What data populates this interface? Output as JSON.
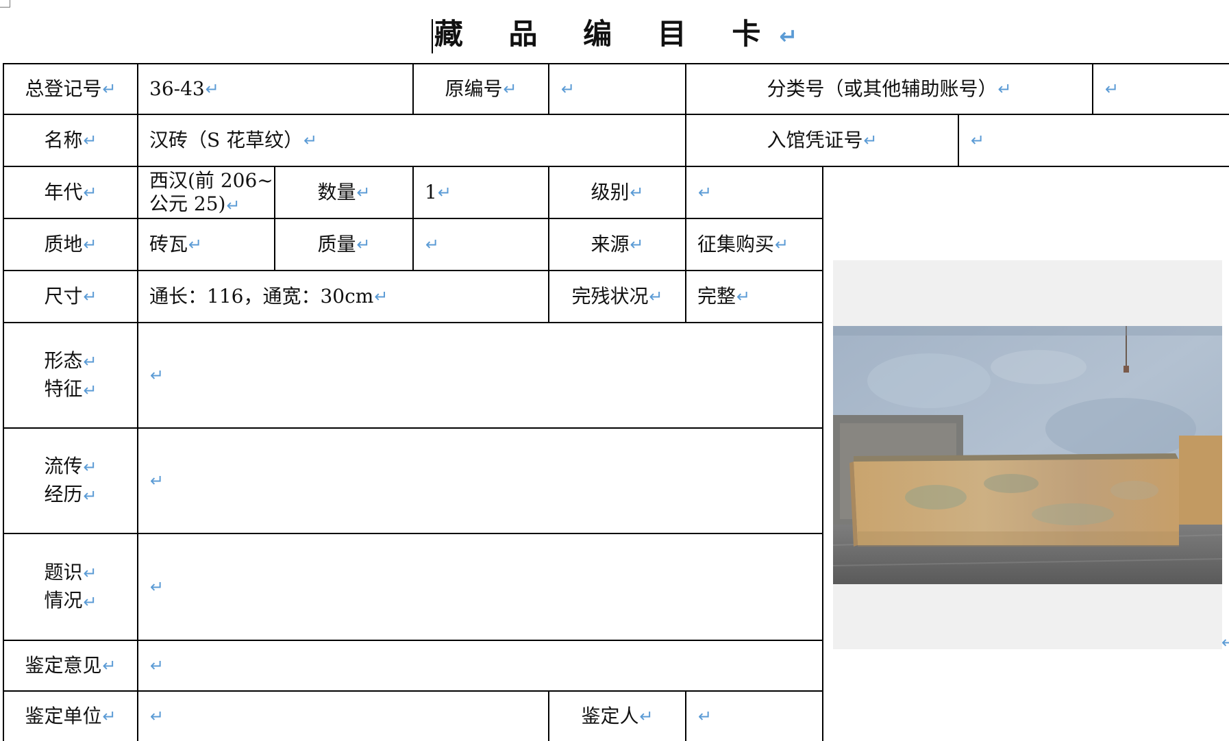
{
  "title": "藏 品 编 目 卡",
  "paragraph_mark": "↵",
  "card": {
    "reg_no_label": "总登记号",
    "reg_no_value": "36-43",
    "orig_no_label": "原编号",
    "orig_no_value": "",
    "class_no_label": "分类号（或其他辅助账号）",
    "class_no_value": "",
    "name_label": "名称",
    "name_value": "汉砖（S 花草纹）",
    "entry_no_label": "入馆凭证号",
    "entry_no_value": "",
    "era_label": "年代",
    "era_value_line1": "西汉(前 206~",
    "era_value_line2": "公元 25)",
    "qty_label": "数量",
    "qty_value": "1",
    "grade_label": "级别",
    "grade_value": "",
    "material_label": "质地",
    "material_value": "砖瓦",
    "mass_label": "质量",
    "mass_value": "",
    "source_label": "来源",
    "source_value": "征集购买",
    "size_label": "尺寸",
    "size_value": "通长：116，通宽：30cm",
    "condition_label": "完残状况",
    "condition_value": "完整",
    "form_label_1": "形态",
    "form_label_2": "特征",
    "form_value": "",
    "history_label_1": "流传",
    "history_label_2": "经历",
    "history_value": "",
    "inscription_label_1": "题识",
    "inscription_label_2": "情况",
    "inscription_value": "",
    "appraisal_label": "鉴定意见",
    "appraisal_value": "",
    "appraisal_unit_label": "鉴定单位",
    "appraisal_unit_value": "",
    "appraiser_label": "鉴定人",
    "appraiser_value": ""
  },
  "colors": {
    "paragraph_mark": "#5b9bd5",
    "photo_wall": "#a9b8c8",
    "photo_brick": "#c7a878",
    "photo_floor": "#6f6f6f"
  }
}
